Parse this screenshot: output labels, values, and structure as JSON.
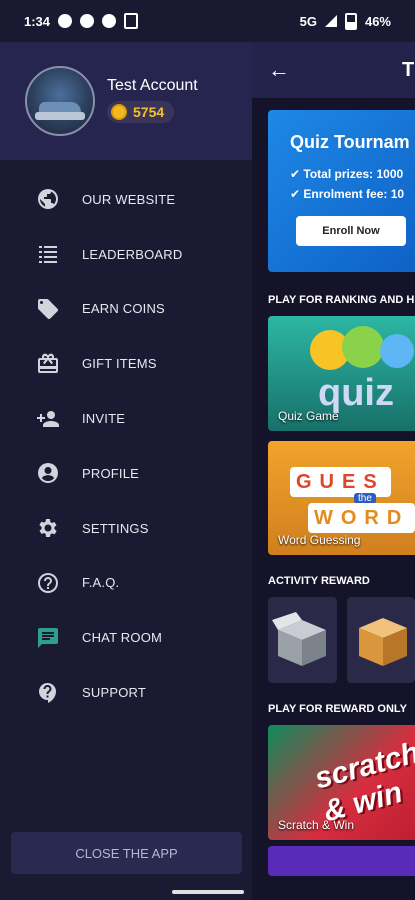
{
  "status_bar": {
    "time": "1:34",
    "network": "5G",
    "battery": "46%"
  },
  "drawer": {
    "account_name": "Test Account",
    "coins": "5754",
    "menu": [
      {
        "label": "OUR WEBSITE",
        "icon": "globe-icon"
      },
      {
        "label": "LEADERBOARD",
        "icon": "list-icon"
      },
      {
        "label": "EARN COINS",
        "icon": "tag-icon"
      },
      {
        "label": "GIFT ITEMS",
        "icon": "gift-icon"
      },
      {
        "label": "INVITE",
        "icon": "person-add-icon"
      },
      {
        "label": "PROFILE",
        "icon": "account-circle-icon"
      },
      {
        "label": "SETTINGS",
        "icon": "gear-icon"
      },
      {
        "label": "F.A.Q.",
        "icon": "help-circle-icon"
      },
      {
        "label": "CHAT ROOM",
        "icon": "chat-icon"
      },
      {
        "label": "SUPPORT",
        "icon": "question-bubble-icon"
      }
    ],
    "close_button": "CLOSE THE APP"
  },
  "main": {
    "title": "T",
    "banner": {
      "title": "Quiz Tournam",
      "prizes": "✔ Total prizes: 1000",
      "fee": "✔ Enrolment fee: 10",
      "button": "Enroll Now"
    },
    "section_ranking": "PLAY FOR RANKING AND H",
    "cards_ranking": [
      "Quiz Game",
      "Word Guessing"
    ],
    "quiz_art_text": "quiz",
    "word_art": {
      "top": "GUES",
      "mid": "the",
      "bottom": "WORD"
    },
    "section_activity": "ACTIVITY REWARD",
    "section_reward": "PLAY FOR REWARD ONLY",
    "cards_reward": [
      "Scratch & Win"
    ],
    "scratch_art_text": "scratch & win"
  },
  "colors": {
    "drawer_bg": "#1b1a33",
    "header_bg": "#262550",
    "coin": "#f3c12a",
    "chat_icon": "#2e9f8c",
    "banner": "#1e88e5"
  }
}
